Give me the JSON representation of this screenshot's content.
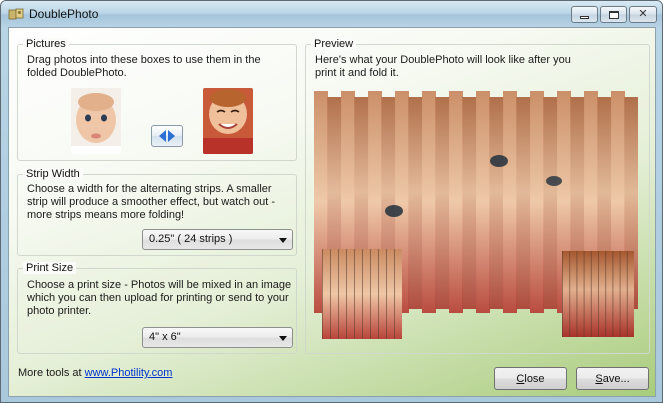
{
  "window": {
    "title": "DoublePhoto",
    "icon": "double-photo-app-icon",
    "controls": [
      "minimize-icon",
      "maximize-icon",
      "close-icon"
    ],
    "close_glyph": "✕"
  },
  "pictures": {
    "legend": "Pictures",
    "instructions": "Drag photos into these boxes to use them in the folded DoublePhoto.",
    "swap_icon": "swap-arrows-icon"
  },
  "strip_width": {
    "legend": "Strip Width",
    "description": "Choose a width for the alternating strips. A smaller strip will produce a smoother effect, but watch out - more strips means more folding!",
    "selected": "0.25\" ( 24 strips )"
  },
  "print_size": {
    "legend": "Print Size",
    "description": "Choose a print size - Photos will be mixed in an image which you can then upload for printing or send to your photo printer.",
    "selected": "4\" x 6\""
  },
  "preview": {
    "legend": "Preview",
    "description": "Here's what your DoublePhoto will look like after you print it and fold it."
  },
  "footer": {
    "more_tools_prefix": "More tools at ",
    "link_text": "www.Photility.com",
    "close_label": "Close",
    "save_label": "Save..."
  },
  "colors": {
    "accent_green": "#a9cc7c",
    "link_blue": "#0033cc",
    "swap_arrow_blue": "#2d6fd2"
  }
}
